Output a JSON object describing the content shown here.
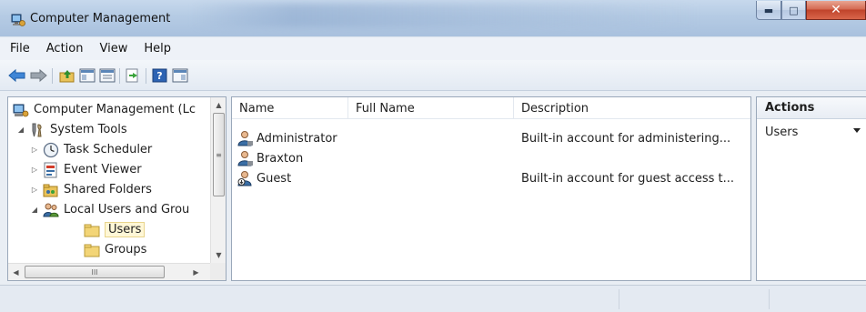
{
  "window": {
    "title": "Computer Management"
  },
  "menu": [
    "File",
    "Action",
    "View",
    "Help"
  ],
  "toolbar": {
    "buttons": [
      "back-icon",
      "forward-icon",
      "up-folder-icon",
      "show-hide-tree-icon",
      "export-list-icon",
      "help-icon",
      "show-hide-action-pane-icon"
    ]
  },
  "tree": {
    "items": [
      {
        "label": "Computer Management (Lc",
        "icon": "computer-management-icon"
      },
      {
        "label": "System Tools",
        "icon": "system-tools-icon"
      },
      {
        "label": "Task Scheduler",
        "icon": "clock-icon"
      },
      {
        "label": "Event Viewer",
        "icon": "event-viewer-icon"
      },
      {
        "label": "Shared Folders",
        "icon": "shared-folder-icon"
      },
      {
        "label": "Local Users and Grou",
        "icon": "users-icon"
      },
      {
        "label": "Users",
        "icon": "folder-icon"
      },
      {
        "label": "Groups",
        "icon": "folder-icon"
      }
    ],
    "selected": "Users",
    "hscroll_grip": "III"
  },
  "list": {
    "columns": [
      "Name",
      "Full Name",
      "Description"
    ],
    "rows": [
      {
        "name": "Administrator",
        "full_name": "",
        "description": "Built-in account for administering...",
        "icon": "user-icon"
      },
      {
        "name": "Braxton",
        "full_name": "",
        "description": "",
        "icon": "user-icon"
      },
      {
        "name": "Guest",
        "full_name": "",
        "description": "Built-in account for guest access t...",
        "icon": "disabled-user-icon"
      }
    ]
  },
  "actions": {
    "title": "Actions",
    "section": "Users"
  },
  "colors": {
    "titlebar": "#b5cbe4",
    "close_button": "#c0432b",
    "pane_border": "#9aa8ba",
    "selection": "#fff7d6"
  }
}
